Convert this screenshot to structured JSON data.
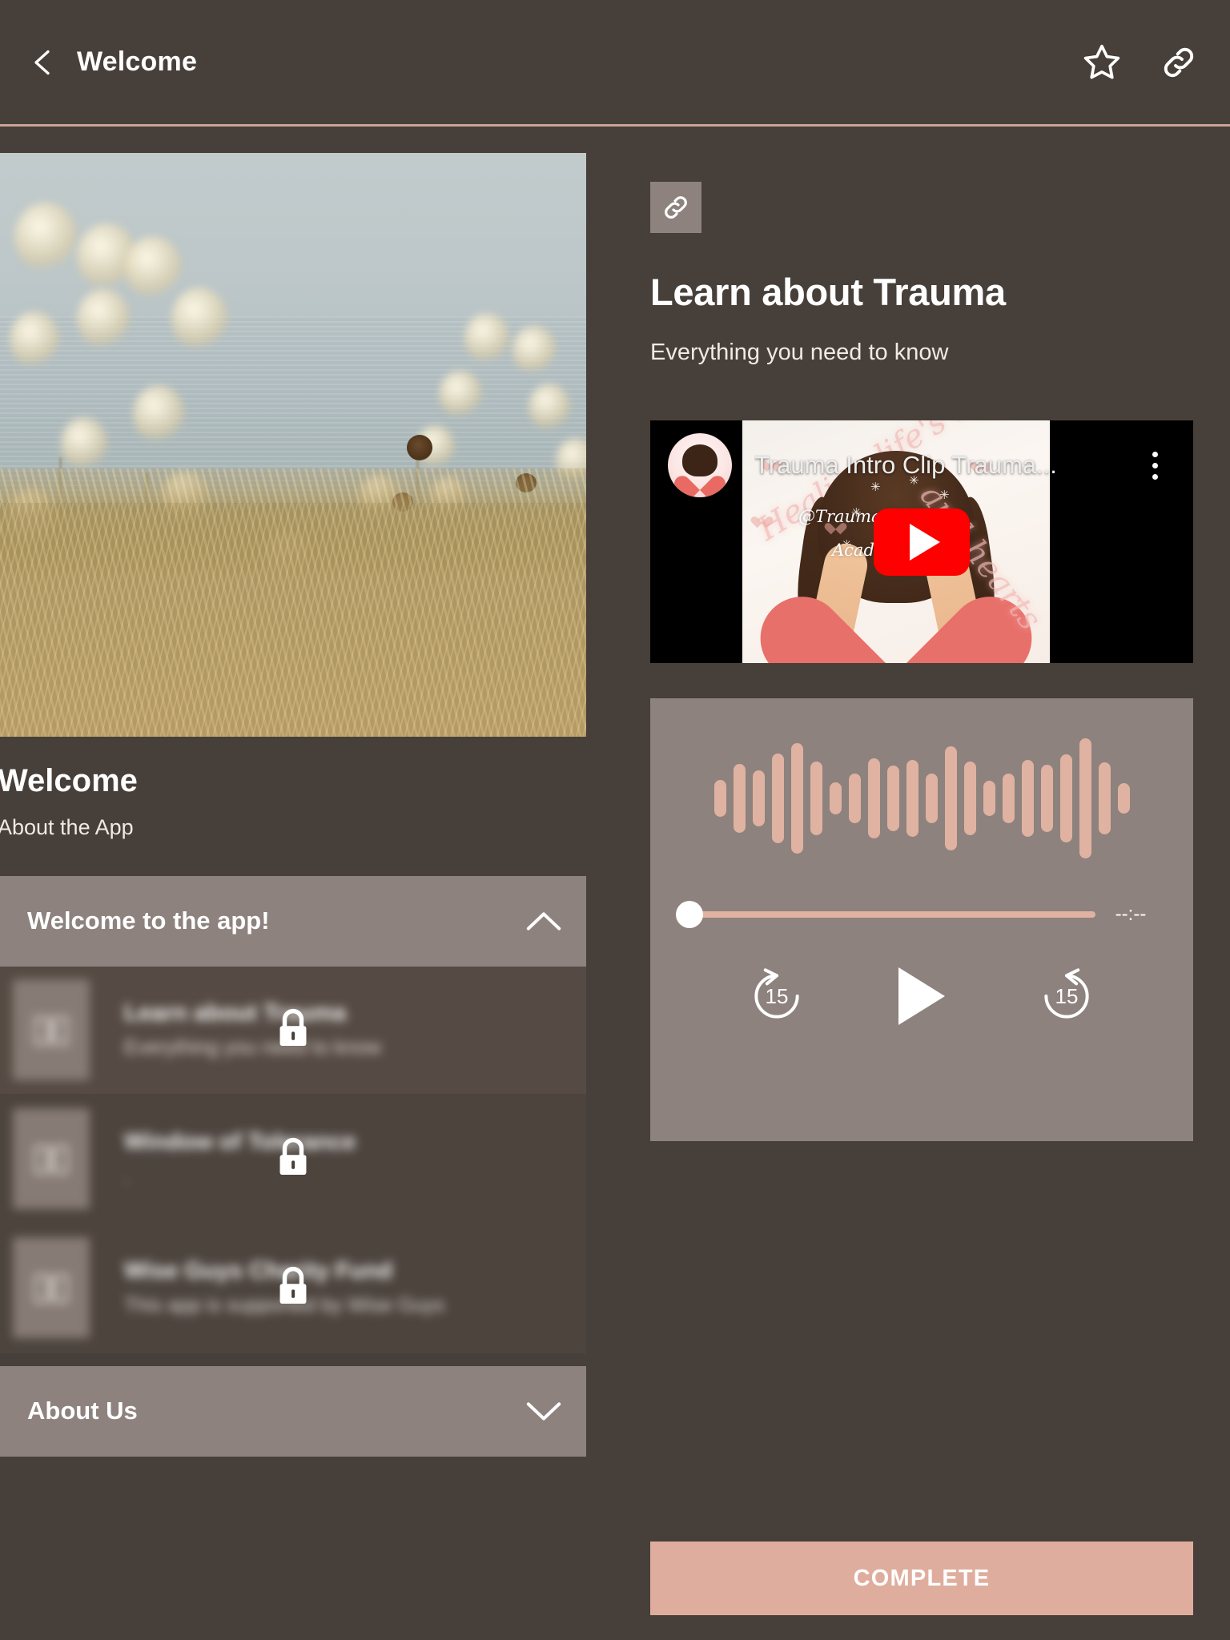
{
  "appbar": {
    "title": "Welcome",
    "back_icon": "chevron-left-icon",
    "favorite_icon": "star-outline-icon",
    "share_icon": "link-icon"
  },
  "left_panel": {
    "hero_image_alt": "meadow-grass-lake-photo",
    "title": "Welcome",
    "subtitle": "About the App",
    "accordion_open": {
      "label": "Welcome to the app!",
      "chevron": "chevron-up-icon",
      "expanded": true
    },
    "lessons": [
      {
        "name": "Learn about Trauma",
        "description": "Everything you need to know",
        "thumb_icon": "book-icon",
        "lock_icon": "lock-icon",
        "locked": true
      },
      {
        "name": "Window of Tolerance",
        "description": ".",
        "thumb_icon": "book-icon",
        "lock_icon": "lock-icon",
        "locked": true
      },
      {
        "name": "Wise Guys Charity Fund",
        "description": "This app is supported by Wise Guys",
        "thumb_icon": "book-icon",
        "lock_icon": "lock-icon",
        "locked": true
      }
    ],
    "accordion_closed": {
      "label": "About Us",
      "chevron": "chevron-down-icon",
      "expanded": false
    }
  },
  "right_panel": {
    "link_chip_icon": "link-icon",
    "title": "Learn about Trauma",
    "subtitle": "Everything you need to know",
    "video": {
      "title": "Trauma Intro Clip Trauma...",
      "channel_avatar": "trauma-healing-academy-avatar",
      "menu_icon": "kebab-menu-icon",
      "play_icon": "youtube-play-icon",
      "thumbnail_line1": "@Trauma Healing",
      "thumbnail_line2": "Academy",
      "thumbnail_script_left": "Healing life's hurts",
      "thumbnail_script_right": "and hearts"
    },
    "audio": {
      "waveform_heights": [
        46,
        86,
        70,
        112,
        138,
        92,
        40,
        62,
        100,
        82,
        96,
        62,
        130,
        92,
        44,
        62,
        96,
        84,
        110,
        150,
        90,
        38
      ],
      "progress_percent": 0,
      "time_display": "--:--",
      "rewind_label": "15",
      "rewind_icon": "replay-15-icon",
      "play_icon": "play-icon",
      "forward_label": "15",
      "forward_icon": "forward-15-icon"
    },
    "complete_button": "COMPLETE"
  },
  "colors": {
    "background": "#473F39",
    "panel": "#8D827D",
    "accent": "#DFAD9D",
    "waveform": "#E0B2A2",
    "divider": "#C9A396",
    "text": "#FFFFFF"
  }
}
